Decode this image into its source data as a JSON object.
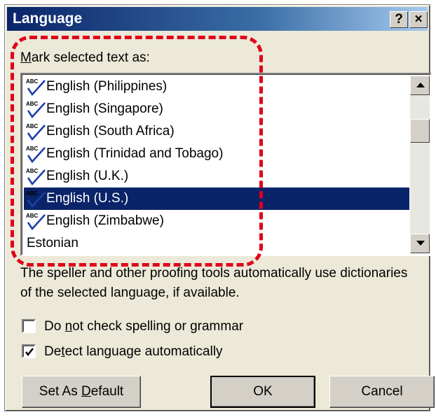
{
  "window": {
    "title": "Language",
    "help_label": "?",
    "close_label": "×"
  },
  "list_label": "Mark selected text as:",
  "languages": [
    {
      "label": "English (Philippines)",
      "icon": "spellcheck-abc-icon",
      "selected": false
    },
    {
      "label": "English (Singapore)",
      "icon": "spellcheck-abc-icon",
      "selected": false
    },
    {
      "label": "English (South Africa)",
      "icon": "spellcheck-abc-icon",
      "selected": false
    },
    {
      "label": "English (Trinidad and Tobago)",
      "icon": "spellcheck-abc-icon",
      "selected": false
    },
    {
      "label": "English (U.K.)",
      "icon": "spellcheck-abc-icon",
      "selected": false
    },
    {
      "label": "English (U.S.)",
      "icon": "spellcheck-abc-icon",
      "selected": true
    },
    {
      "label": "English (Zimbabwe)",
      "icon": "spellcheck-abc-icon",
      "selected": false
    },
    {
      "label": "Estonian",
      "icon": "",
      "selected": false
    }
  ],
  "description": "The speller and other proofing tools automatically use dictionaries of the selected language, if available.",
  "checkboxes": {
    "no_check": {
      "label_pre": "Do ",
      "label_key": "n",
      "label_post": "ot check spelling or grammar",
      "checked": false
    },
    "detect": {
      "label_pre": "De",
      "label_key": "t",
      "label_post": "ect language automatically",
      "checked": true
    }
  },
  "buttons": {
    "set_default": {
      "pre": "Set As ",
      "key": "D",
      "post": "efault"
    },
    "ok": "OK",
    "cancel": "Cancel"
  },
  "colors": {
    "selection": "#0a246a",
    "annotation": "#e0001a",
    "dialog_bg": "#ece9d8"
  }
}
